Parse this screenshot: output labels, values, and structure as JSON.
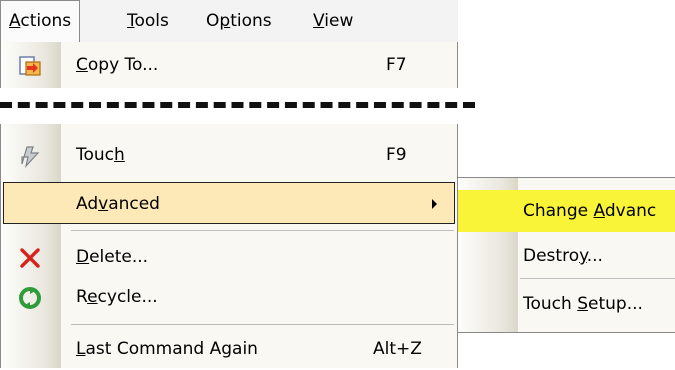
{
  "menubar": {
    "items": [
      {
        "pre": "",
        "key": "A",
        "post": "ctions"
      },
      {
        "pre": "",
        "key": "T",
        "post": "ools"
      },
      {
        "pre": "O",
        "key": "p",
        "post": "tions"
      },
      {
        "pre": "",
        "key": "V",
        "post": "iew"
      }
    ]
  },
  "menu": {
    "copy_to": {
      "pre": "",
      "key": "C",
      "post": "opy To...",
      "accel": "F7"
    },
    "touch": {
      "pre": "Touc",
      "key": "h",
      "post": "",
      "accel": "F9"
    },
    "advanced": {
      "pre": "Ad",
      "key": "v",
      "post": "anced"
    },
    "delete": {
      "pre": "",
      "key": "D",
      "post": "elete..."
    },
    "recycle": {
      "pre": "R",
      "key": "e",
      "post": "cycle..."
    },
    "last_command": {
      "pre": "",
      "key": "L",
      "post": "ast Command Again",
      "accel": "Alt+Z"
    }
  },
  "submenu": {
    "change": {
      "pre": "Change ",
      "key": "A",
      "post": "dvanc"
    },
    "destroy": {
      "pre": "Destro",
      "key": "y",
      "post": "..."
    },
    "touch_setup": {
      "pre": "Touch ",
      "key": "S",
      "post": "etup..."
    }
  },
  "colors": {
    "highlight": "#fde9b8",
    "sub_highlight": "#f9f437",
    "gutter": "#e9e7dd"
  },
  "icons": [
    "copy-to-icon",
    "touch-icon",
    "delete-icon",
    "recycle-icon"
  ]
}
